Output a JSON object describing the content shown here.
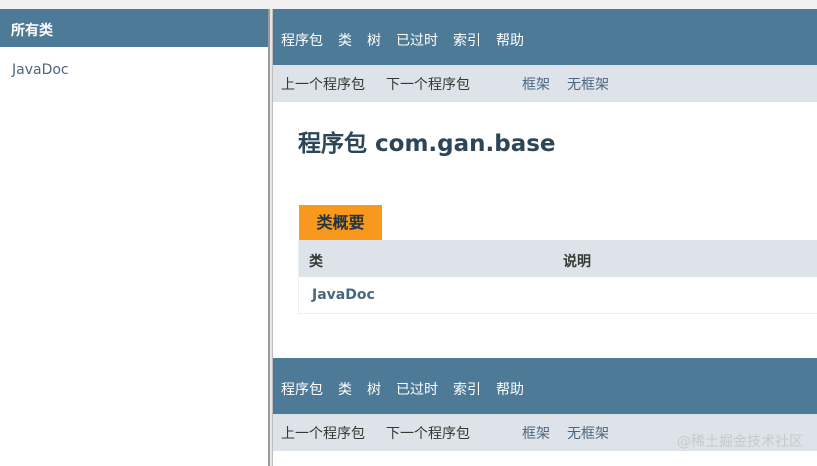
{
  "left": {
    "header": "所有类",
    "items": [
      "JavaDoc"
    ]
  },
  "nav": {
    "items": [
      "程序包",
      "类",
      "树",
      "已过时",
      "索引",
      "帮助"
    ]
  },
  "subnav": {
    "prev": "上一个程序包",
    "next": "下一个程序包",
    "frames": "框架",
    "no_frames": "无框架"
  },
  "page": {
    "title": "程序包 com.gan.base"
  },
  "summary": {
    "tab": "类概要",
    "columns": [
      "类",
      "说明"
    ],
    "rows": [
      {
        "class": "JavaDoc",
        "description": ""
      }
    ]
  },
  "watermark": "@稀土掘金技术社区",
  "colors": {
    "nav": "#4d7a97",
    "subnav": "#dee3e9",
    "tab": "#f8981d",
    "link": "#4a6782"
  }
}
